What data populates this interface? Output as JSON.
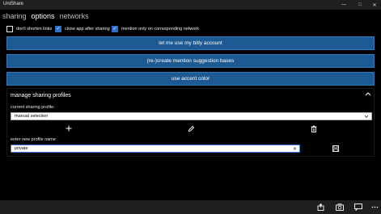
{
  "window": {
    "title": "UniShare",
    "minimize_glyph": "—",
    "maximize_glyph": "□",
    "close_glyph": "✕"
  },
  "tabs": [
    {
      "label": "sharing",
      "active": false
    },
    {
      "label": "options",
      "active": true
    },
    {
      "label": "networks",
      "active": false
    }
  ],
  "checkboxes": [
    {
      "label": "don't shorten links",
      "checked": false
    },
    {
      "label": "close app after sharing",
      "checked": true
    },
    {
      "label": "mention only on corresponding network",
      "checked": true
    }
  ],
  "buttons": {
    "bitly": "let me use my bitly account",
    "recreate": "(re-)create mention suggestion bases",
    "accent": "use accent color"
  },
  "profiles": {
    "title": "manage sharing profiles",
    "current_label": "current sharing profile:",
    "current_value": "manual selection",
    "new_label": "enter new profile name",
    "new_value": "private"
  },
  "colors": {
    "accent": "#1d5a94",
    "checkbox": "#2f6fc9"
  }
}
